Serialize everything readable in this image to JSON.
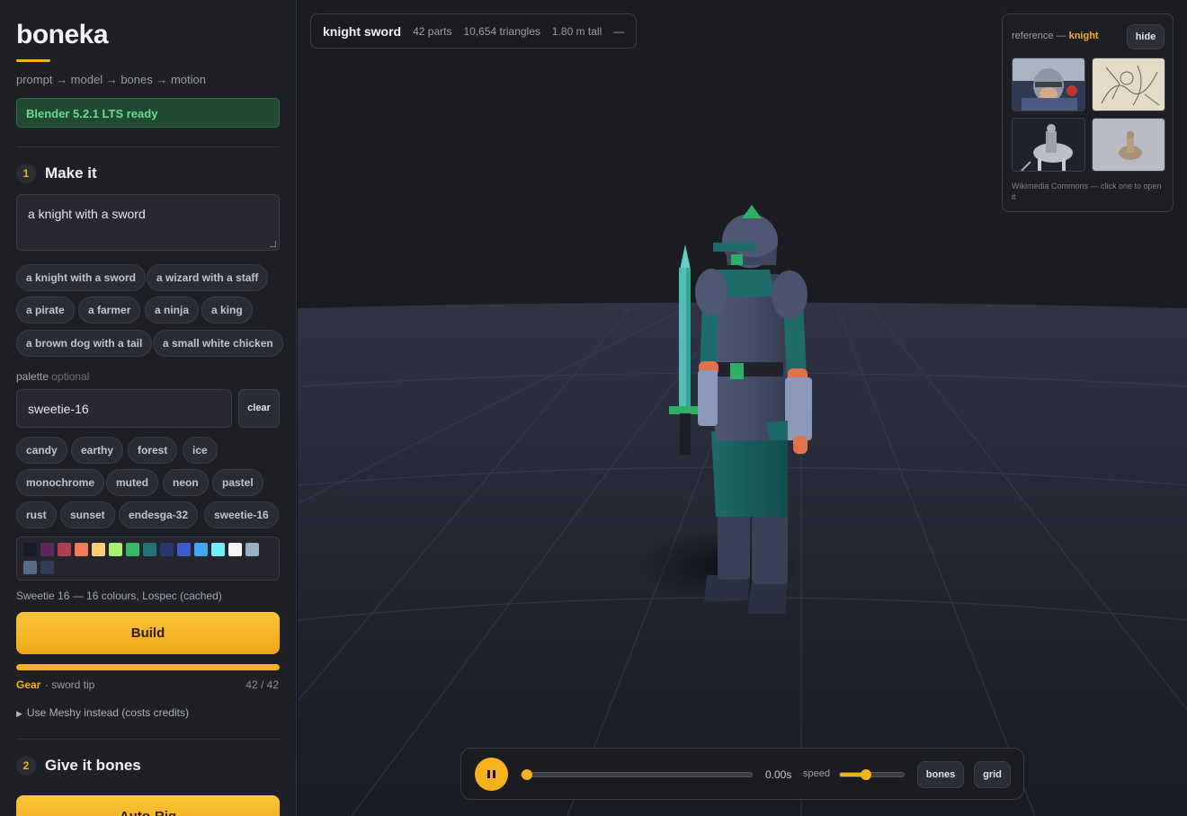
{
  "sidebar": {
    "brand": "boneka",
    "tagline": "prompt → model → bones → motion",
    "status": "Blender 5.2.1 LTS ready",
    "step1": {
      "num": "1",
      "title": "Make it"
    },
    "prompt_value": "a knight with a sword",
    "prompt_chips": [
      "a knight with a sword",
      "a wizard with a staff",
      "a pirate",
      "a farmer",
      "a ninja",
      "a king",
      "a brown dog with a tail",
      "a small white chicken"
    ],
    "palette_label": "palette",
    "palette_optional": "optional",
    "palette_value": "sweetie-16",
    "clear_label": "clear",
    "palette_chips": [
      "candy",
      "earthy",
      "forest",
      "ice",
      "monochrome",
      "muted",
      "neon",
      "pastel",
      "rust",
      "sunset",
      "endesga-32",
      "sweetie-16"
    ],
    "swatches": [
      "#1a1c2c",
      "#5d275d",
      "#b13e53",
      "#ef7d57",
      "#ffcd75",
      "#a7f070",
      "#38b764",
      "#257179",
      "#29366f",
      "#3b5dc9",
      "#41a6f6",
      "#73eff7",
      "#f4f4f4",
      "#94b0c2",
      "#566c86",
      "#333c57"
    ],
    "palette_desc": "Sweetie 16 — 16 colours, Lospec (cached)",
    "build_label": "Build",
    "progress": {
      "fraction": 1.0,
      "stage": "Gear",
      "detail": "· sword tip",
      "count": "42 / 42"
    },
    "meshy_label": "Use Meshy instead (costs credits)",
    "step2": {
      "num": "2",
      "title": "Give it bones"
    },
    "autorig_label": "Auto-Rig"
  },
  "viewport": {
    "info": {
      "name": "knight sword",
      "parts": "42 parts",
      "triangles": "10,654 triangles",
      "height": "1.80 m tall",
      "extra": "—"
    },
    "reference": {
      "label": "reference —",
      "subject": "knight",
      "hide_label": "hide",
      "note": "Wikimedia Commons — click one to open it"
    },
    "player": {
      "time": "0.00s",
      "speed_label": "speed",
      "timeline_fraction": 0.0,
      "speed_fraction": 0.4,
      "bones_label": "bones",
      "grid_label": "grid"
    }
  },
  "colors": {
    "accent": "#f5b21e",
    "ready": "#6bdc8e"
  }
}
